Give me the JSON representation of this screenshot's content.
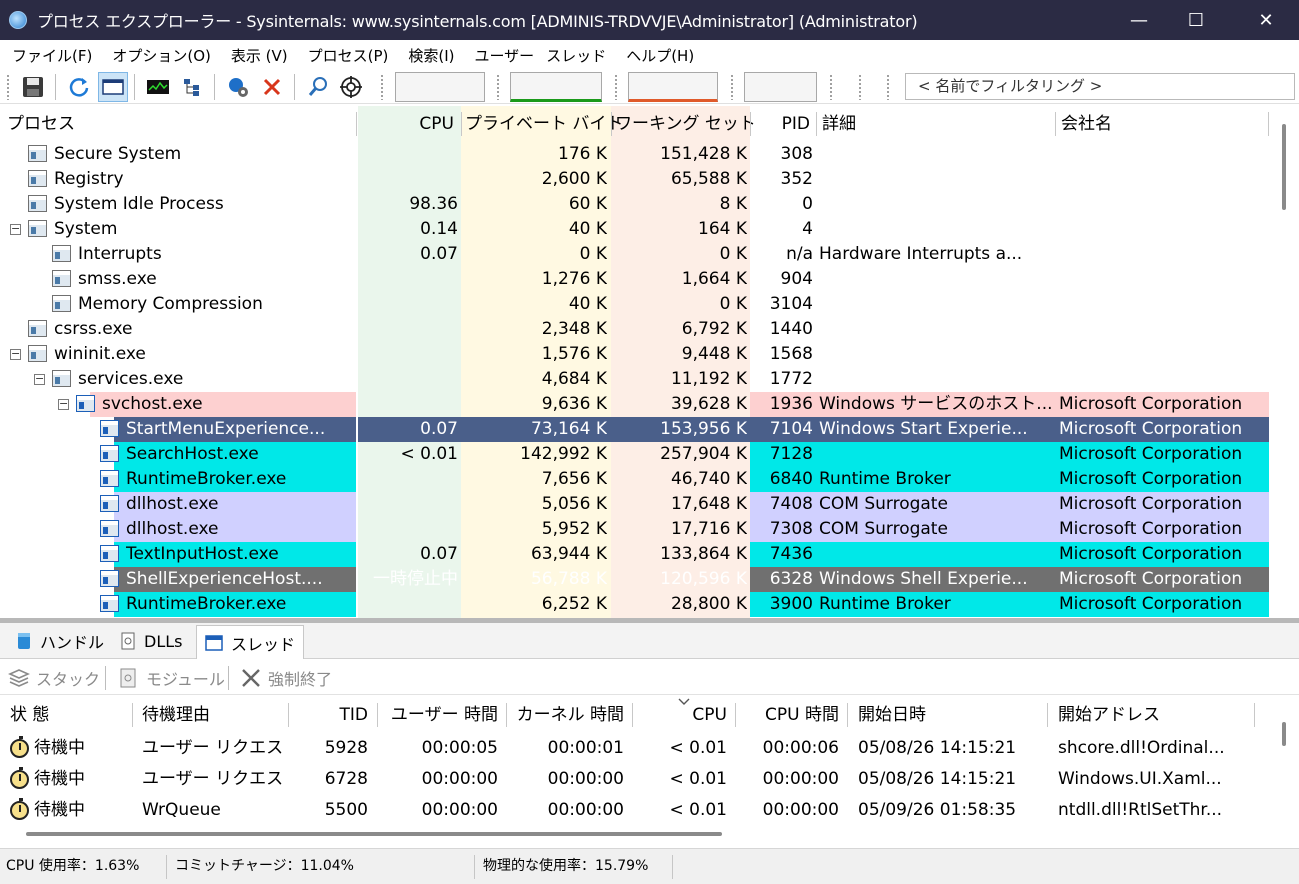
{
  "window": {
    "title": "プロセス エクスプローラー - Sysinternals: www.sysinternals.com [ADMINIS-TRDVVJE\\Administrator] (Administrator)",
    "minimize": "—",
    "maximize": "☐",
    "close": "✕"
  },
  "menu": [
    "ファイル(F)",
    "オプション(O)",
    "表示 (V)",
    "プロセス(P)",
    "検索(I)",
    "ユーザー",
    "スレッド",
    "ヘルプ(H)"
  ],
  "toolbar": {
    "filter_placeholder": "< 名前でフィルタリング >",
    "icons": [
      "save-icon",
      "refresh-icon",
      "window-icon",
      "system-info-icon",
      "tree-icon",
      "properties-icon",
      "kill-icon",
      "find-icon",
      "target-icon"
    ],
    "colors": {
      "cpu_graph": "#1a9a1a",
      "commit_graph": "#c8a000",
      "io_graph": "#e05a2a"
    }
  },
  "process_columns": {
    "process": "プロセス",
    "cpu": "CPU",
    "private_bytes": "プライベート バイト",
    "working_set": "ワーキング セット",
    "pid": "PID",
    "description": "詳細",
    "company": "会社名"
  },
  "processes": [
    {
      "name": "Secure System",
      "cpu": "",
      "private": "176 K",
      "ws": "151,428 K",
      "pid": "308",
      "desc": "",
      "company": "",
      "indent": 0,
      "toggle": "",
      "color": "",
      "icon": "process-icon"
    },
    {
      "name": "Registry",
      "cpu": "",
      "private": "2,600 K",
      "ws": "65,588 K",
      "pid": "352",
      "desc": "",
      "company": "",
      "indent": 0,
      "toggle": "",
      "color": "",
      "icon": "process-icon"
    },
    {
      "name": "System Idle Process",
      "cpu": "98.36",
      "private": "60 K",
      "ws": "8 K",
      "pid": "0",
      "desc": "",
      "company": "",
      "indent": 0,
      "toggle": "",
      "color": "",
      "icon": "process-icon"
    },
    {
      "name": "System",
      "cpu": "0.14",
      "private": "40 K",
      "ws": "164 K",
      "pid": "4",
      "desc": "",
      "company": "",
      "indent": 0,
      "toggle": "⊟",
      "color": "",
      "icon": "process-icon"
    },
    {
      "name": "Interrupts",
      "cpu": "0.07",
      "private": "0 K",
      "ws": "0 K",
      "pid": "n/a",
      "desc": "Hardware Interrupts a...",
      "company": "",
      "indent": 1,
      "toggle": "",
      "color": "",
      "icon": "process-icon"
    },
    {
      "name": "smss.exe",
      "cpu": "",
      "private": "1,276 K",
      "ws": "1,664 K",
      "pid": "904",
      "desc": "",
      "company": "",
      "indent": 1,
      "toggle": "",
      "color": "",
      "icon": "process-icon"
    },
    {
      "name": "Memory Compression",
      "cpu": "",
      "private": "40 K",
      "ws": "0 K",
      "pid": "3104",
      "desc": "",
      "company": "",
      "indent": 1,
      "toggle": "",
      "color": "",
      "icon": "process-icon"
    },
    {
      "name": "csrss.exe",
      "cpu": "",
      "private": "2,348 K",
      "ws": "6,792 K",
      "pid": "1440",
      "desc": "",
      "company": "",
      "indent": 0,
      "toggle": "",
      "color": "",
      "icon": "process-icon"
    },
    {
      "name": "wininit.exe",
      "cpu": "",
      "private": "1,576 K",
      "ws": "9,448 K",
      "pid": "1568",
      "desc": "",
      "company": "",
      "indent": 0,
      "toggle": "⊟",
      "color": "",
      "icon": "process-icon"
    },
    {
      "name": "services.exe",
      "cpu": "",
      "private": "4,684 K",
      "ws": "11,192 K",
      "pid": "1772",
      "desc": "",
      "company": "",
      "indent": 1,
      "toggle": "⊟",
      "color": "",
      "icon": "process-icon"
    },
    {
      "name": "svchost.exe",
      "cpu": "",
      "private": "9,636 K",
      "ws": "39,628 K",
      "pid": "1936",
      "desc": "Windows サービスのホスト...",
      "company": "Microsoft Corporation",
      "indent": 2,
      "toggle": "⊟",
      "color": "#fdd0d0",
      "icon": "window-process-icon"
    },
    {
      "name": "StartMenuExperience...",
      "cpu": "0.07",
      "private": "73,164 K",
      "ws": "153,956 K",
      "pid": "7104",
      "desc": "Windows Start Experie...",
      "company": "Microsoft Corporation",
      "indent": 3,
      "toggle": "",
      "color": "#4a5f8a",
      "icon": "window-process-icon"
    },
    {
      "name": "SearchHost.exe",
      "cpu": "< 0.01",
      "private": "142,992 K",
      "ws": "257,904 K",
      "pid": "7128",
      "desc": "",
      "company": "Microsoft Corporation",
      "indent": 3,
      "toggle": "",
      "color": "#00e8e8",
      "icon": "window-process-icon"
    },
    {
      "name": "RuntimeBroker.exe",
      "cpu": "",
      "private": "7,656 K",
      "ws": "46,740 K",
      "pid": "6840",
      "desc": "Runtime Broker",
      "company": "Microsoft Corporation",
      "indent": 3,
      "toggle": "",
      "color": "#00e8e8",
      "icon": "window-process-icon"
    },
    {
      "name": "dllhost.exe",
      "cpu": "",
      "private": "5,056 K",
      "ws": "17,648 K",
      "pid": "7408",
      "desc": "COM Surrogate",
      "company": "Microsoft Corporation",
      "indent": 3,
      "toggle": "",
      "color": "#d0d0ff",
      "icon": "window-process-icon"
    },
    {
      "name": "dllhost.exe",
      "cpu": "",
      "private": "5,952 K",
      "ws": "17,716 K",
      "pid": "7308",
      "desc": "COM Surrogate",
      "company": "Microsoft Corporation",
      "indent": 3,
      "toggle": "",
      "color": "#d0d0ff",
      "icon": "window-process-icon"
    },
    {
      "name": "TextInputHost.exe",
      "cpu": "0.07",
      "private": "63,944 K",
      "ws": "133,864 K",
      "pid": "7436",
      "desc": "",
      "company": "Microsoft Corporation",
      "indent": 3,
      "toggle": "",
      "color": "#00e8e8",
      "icon": "window-process-icon"
    },
    {
      "name": "ShellExperienceHost....",
      "cpu": "一時停止中",
      "private": "56,788 K",
      "ws": "120,596 K",
      "pid": "6328",
      "desc": "Windows Shell Experie...",
      "company": "Microsoft Corporation",
      "indent": 3,
      "toggle": "",
      "color": "#707070",
      "icon": "window-process-icon"
    },
    {
      "name": "RuntimeBroker.exe",
      "cpu": "",
      "private": "6,252 K",
      "ws": "28,800 K",
      "pid": "3900",
      "desc": "Runtime Broker",
      "company": "Microsoft Corporation",
      "indent": 3,
      "toggle": "",
      "color": "#00e8e8",
      "icon": "window-process-icon"
    }
  ],
  "tabs": [
    {
      "label": "ハンドル",
      "icon": "handle-icon"
    },
    {
      "label": "DLLs",
      "icon": "dll-icon"
    },
    {
      "label": "スレッド",
      "icon": "thread-icon",
      "selected": true
    }
  ],
  "thread_toolbar": {
    "stack": "スタック",
    "module": "モジュール",
    "kill": "強制終了"
  },
  "thread_columns": {
    "state": "状 態",
    "wait_reason": "待機理由",
    "tid": "TID",
    "user_time": "ユーザー 時間",
    "kernel_time": "カーネル 時間",
    "cpu": "CPU",
    "cpu_time": "CPU 時間",
    "start_date": "開始日時",
    "start_address": "開始アドレス"
  },
  "threads": [
    {
      "state": "待機中",
      "wait_reason": "ユーザー リクエスト",
      "tid": "5928",
      "user_time": "00:00:05",
      "kernel_time": "00:00:01",
      "cpu": "< 0.01",
      "cpu_time": "00:00:06",
      "start_date": "05/08/26 14:15:21",
      "start_address": "shcore.dll!Ordinal..."
    },
    {
      "state": "待機中",
      "wait_reason": "ユーザー リクエスト",
      "tid": "6728",
      "user_time": "00:00:00",
      "kernel_time": "00:00:00",
      "cpu": "< 0.01",
      "cpu_time": "00:00:00",
      "start_date": "05/08/26 14:15:21",
      "start_address": "Windows.UI.Xaml..."
    },
    {
      "state": "待機中",
      "wait_reason": "WrQueue",
      "tid": "5500",
      "user_time": "00:00:00",
      "kernel_time": "00:00:00",
      "cpu": "< 0.01",
      "cpu_time": "00:00:00",
      "start_date": "05/09/26 01:58:35",
      "start_address": "ntdll.dll!RtlSetThr..."
    }
  ],
  "status": {
    "cpu": "CPU 使用率：1.63%",
    "commit": "コミットチャージ：11.04%",
    "physical": "物理的な使用率：15.79%"
  }
}
